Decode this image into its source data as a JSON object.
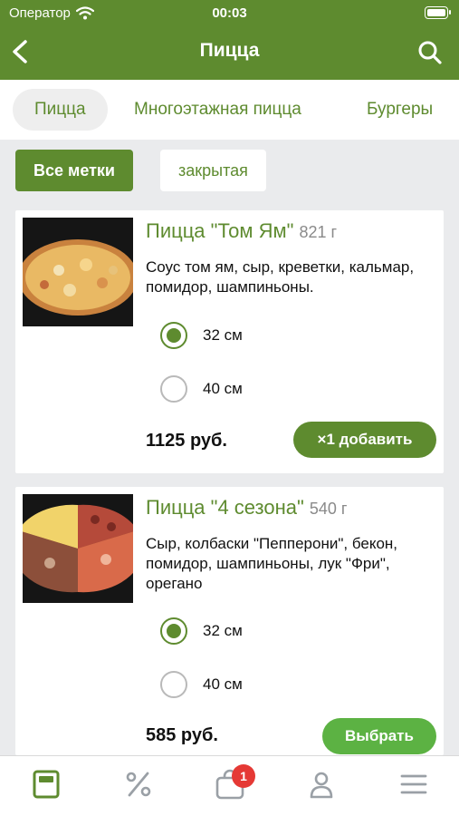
{
  "status": {
    "carrier": "Оператор",
    "time": "00:03"
  },
  "nav": {
    "title": "Пицца"
  },
  "tabs": [
    {
      "label": "Пицца",
      "active": true
    },
    {
      "label": "Многоэтажная пицца",
      "active": false
    },
    {
      "label": "Бургеры",
      "active": false
    }
  ],
  "filters": [
    {
      "label": "Все метки",
      "active": true
    },
    {
      "label": "закрытая",
      "active": false
    }
  ],
  "products": [
    {
      "title": "Пицца \"Том Ям\"",
      "weight": "821 г",
      "description": "Соус том ям, сыр, креветки, кальмар, помидор, шампиньоны.",
      "sizes": [
        {
          "label": "32 см",
          "selected": true
        },
        {
          "label": "40 см",
          "selected": false
        }
      ],
      "price": "1125 руб.",
      "button": "×1 добавить"
    },
    {
      "title": "Пицца \"4 сезона\"",
      "weight": "540 г",
      "description": "Сыр, колбаски \"Пепперони\", бекон, помидор, шампиньоны, лук \"Фри\", орегано",
      "sizes": [
        {
          "label": "32 см",
          "selected": true
        },
        {
          "label": "40 см",
          "selected": false
        }
      ],
      "price": "585 руб.",
      "button": "Выбрать"
    }
  ],
  "tabbar": {
    "cart_badge": "1"
  },
  "colors": {
    "brand": "#5e8b2f",
    "accent_button": "#5cb243",
    "badge": "#e53935"
  }
}
